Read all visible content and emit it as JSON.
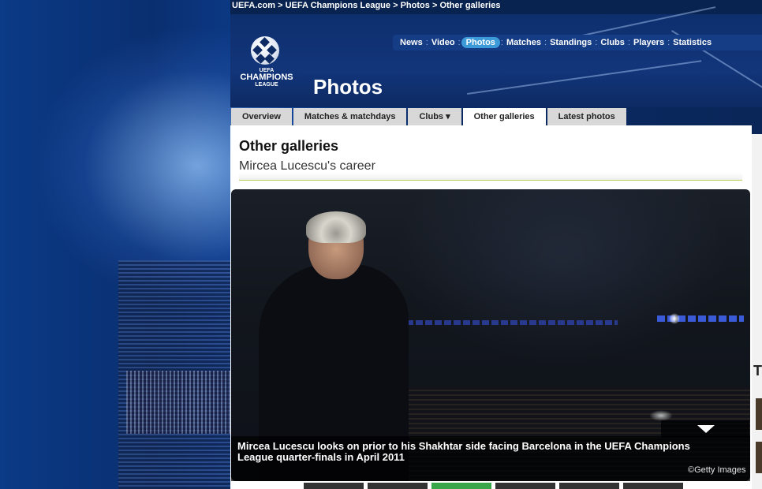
{
  "breadcrumb": {
    "items": [
      "UEFA.com",
      "UEFA Champions League",
      "Photos",
      "Other galleries"
    ],
    "separator": ">"
  },
  "logo": {
    "line1": "UEFA",
    "line2": "CHAMPIONS",
    "line3": "LEAGUE"
  },
  "page_title": "Photos",
  "main_nav": {
    "items": [
      {
        "label": "News"
      },
      {
        "label": "Video"
      },
      {
        "label": "Photos",
        "active": true
      },
      {
        "label": "Matches"
      },
      {
        "label": "Standings"
      },
      {
        "label": "Clubs"
      },
      {
        "label": "Players"
      },
      {
        "label": "Statistics"
      }
    ],
    "accent_color": "#3d9ad8"
  },
  "sub_tabs": [
    {
      "label": "Overview"
    },
    {
      "label": "Matches & matchdays"
    },
    {
      "label": "Clubs ▾"
    },
    {
      "label": "Other galleries",
      "active": true
    },
    {
      "label": "Latest photos"
    }
  ],
  "section": {
    "title": "Other galleries",
    "subtitle": "Mircea Lucescu's career",
    "rule_color": "#b5cf5a"
  },
  "photo": {
    "caption": "Mircea Lucescu looks on prior to his Shakhtar side facing Barcelona in the UEFA Champions League quarter-finals in April 2011",
    "credit": "©Getty Images",
    "toggle_icon": "triangle-down-icon"
  },
  "sidebar": {
    "heading_fragment": "T"
  }
}
